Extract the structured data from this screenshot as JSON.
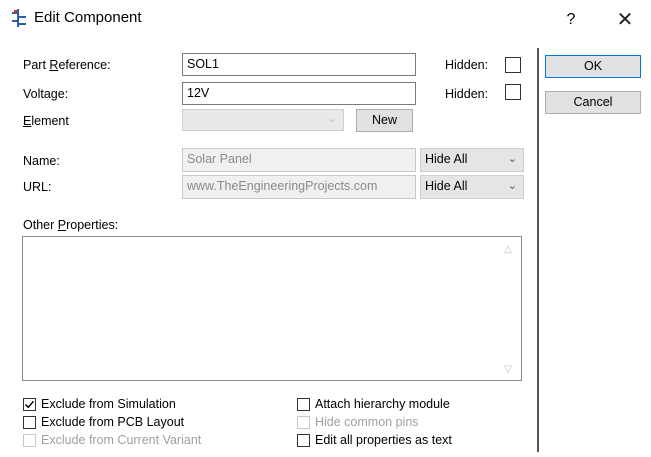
{
  "window": {
    "title": "Edit Component",
    "help": "?",
    "close": "✕"
  },
  "fields": {
    "part_reference": {
      "label_pre": "Part ",
      "label_u": "R",
      "label_post": "eference:",
      "value": "SOL1",
      "hidden_label": "Hidden:"
    },
    "voltage": {
      "label": "Voltage:",
      "value": "12V",
      "hidden_label": "Hidden:"
    },
    "element": {
      "label_u": "E",
      "label_post": "lement",
      "value": "",
      "new_label": "New"
    },
    "name": {
      "label": "Name:",
      "value": "Solar Panel",
      "visibility": "Hide All"
    },
    "url": {
      "label": "URL:",
      "value": "www.TheEngineeringProjects.com",
      "visibility": "Hide All"
    },
    "other_properties": {
      "label_pre": "Other ",
      "label_u": "P",
      "label_post": "roperties:",
      "value": ""
    }
  },
  "buttons": {
    "ok": "OK",
    "cancel": "Cancel"
  },
  "checkboxes": {
    "exclude_simulation": {
      "label": "Exclude from Simulation",
      "checked": true,
      "enabled": true
    },
    "exclude_pcb": {
      "label": "Exclude from PCB Layout",
      "checked": false,
      "enabled": true
    },
    "exclude_variant": {
      "label": "Exclude from Current Variant",
      "checked": false,
      "enabled": false
    },
    "attach_hierarchy": {
      "label": "Attach hierarchy module",
      "checked": false,
      "enabled": true
    },
    "hide_common_pins": {
      "label": "Hide common pins",
      "checked": false,
      "enabled": false
    },
    "edit_all_text": {
      "label": "Edit all properties as text",
      "checked": false,
      "enabled": true
    }
  },
  "colors": {
    "accent": "#0078d7",
    "disabled_text": "#8a8a8a"
  }
}
